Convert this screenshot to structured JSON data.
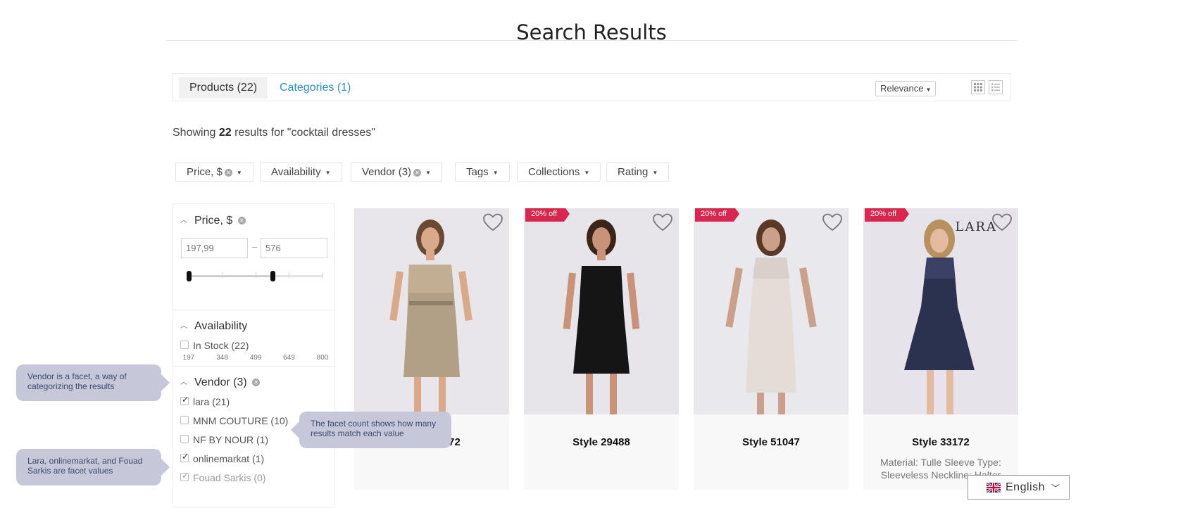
{
  "page": {
    "title": "Search Results"
  },
  "tabs": {
    "products_label": "Products (22)",
    "categories_label": "Categories (1)"
  },
  "sort": {
    "selected": "Relevance"
  },
  "view_modes": [
    "grid-view-icon",
    "list-view-icon"
  ],
  "results": {
    "prefix": "Showing",
    "count": "22",
    "suffix": "results for \"cocktail dresses\""
  },
  "facet_chips": [
    {
      "label": "Price, $",
      "clearable": true
    },
    {
      "label": "Availability",
      "clearable": false
    },
    {
      "label": "Vendor (3)",
      "clearable": true
    },
    {
      "label": "Tags",
      "clearable": false
    },
    {
      "label": "Collections",
      "clearable": false
    },
    {
      "label": "Rating",
      "clearable": false
    }
  ],
  "sidebar": {
    "price": {
      "heading": "Price, $",
      "min_value": "197,99",
      "max_value": "576",
      "ticks": [
        "197",
        "348",
        "499",
        "649",
        "800"
      ],
      "range_low": 197.99,
      "range_high": 576,
      "scale_min": 197,
      "scale_max": 800
    },
    "availability": {
      "heading": "Availability",
      "options": [
        {
          "label": "In Stock (22)",
          "checked": false
        }
      ]
    },
    "vendor": {
      "heading": "Vendor (3)",
      "options": [
        {
          "label": "lara (21)",
          "checked": true
        },
        {
          "label": "MNM COUTURE (10)",
          "checked": false
        },
        {
          "label": "NF BY NOUR (1)",
          "checked": false
        },
        {
          "label": "onlinemarkat (1)",
          "checked": true
        },
        {
          "label": "Fouad Sarkis (0)",
          "checked": true,
          "disabled": true
        }
      ]
    }
  },
  "products": [
    {
      "name": "Style 29572",
      "badge": "",
      "desc": ""
    },
    {
      "name": "Style 29488",
      "badge": "20% off",
      "desc": ""
    },
    {
      "name": "Style 51047",
      "badge": "20% off",
      "desc": ""
    },
    {
      "name": "Style 33172",
      "badge": "20% off",
      "desc": "Material: Tulle Sleeve Type: Sleeveless Neckline: Halter",
      "logo": "LARA"
    }
  ],
  "callouts": {
    "vendor_facet": "Vendor is a facet, a way of categorizing the results",
    "facet_values": "Lara, onlinemarkat, and Fouad Sarkis are facet values",
    "facet_count": "The facet count shows how many results match each value"
  },
  "language": {
    "selected": "English"
  },
  "colors": {
    "accent_blue": "#2b8fcb",
    "badge_red": "#d8264e",
    "callout_bg": "#c6c8da"
  }
}
